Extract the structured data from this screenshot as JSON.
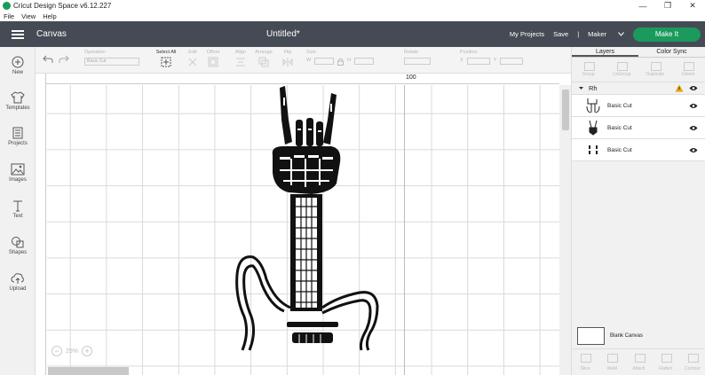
{
  "app": {
    "title": "Cricut Design Space  v6.12.227"
  },
  "menu": [
    "File",
    "View",
    "Help"
  ],
  "header": {
    "section": "Canvas",
    "doc_title": "Untitled*",
    "my_projects": "My Projects",
    "save": "Save",
    "separator": "|",
    "machine": "Maker",
    "make_it": "Make It"
  },
  "sidebar": [
    {
      "label": "New",
      "icon": "plus-circle-icon"
    },
    {
      "label": "Templates",
      "icon": "shirt-icon"
    },
    {
      "label": "Projects",
      "icon": "projects-icon"
    },
    {
      "label": "Images",
      "icon": "image-icon"
    },
    {
      "label": "Text",
      "icon": "text-icon"
    },
    {
      "label": "Shapes",
      "icon": "shapes-icon"
    },
    {
      "label": "Upload",
      "icon": "upload-icon"
    }
  ],
  "toolbar": {
    "operation_label": "Operation",
    "operation_value": "Basic Cut",
    "select_all": "Select All",
    "edit": "Edit",
    "offset": "Offset",
    "align": "Align",
    "arrange": "Arrange",
    "flip": "Flip",
    "size": "Size",
    "w": "W",
    "h": "H",
    "rotate": "Rotate",
    "position": "Position",
    "x": "X",
    "y": "Y"
  },
  "canvas": {
    "ruler_mark": "100",
    "zoom": "25%"
  },
  "panel": {
    "tabs": [
      "Layers",
      "Color Sync"
    ],
    "top_tools": [
      "Group",
      "UnGroup",
      "Duplicate",
      "Delete"
    ],
    "group_name": "Rh",
    "layers": [
      {
        "name": "Basic Cut"
      },
      {
        "name": "Basic Cut"
      },
      {
        "name": "Basic Cut"
      }
    ],
    "blank_canvas": "Blank Canvas",
    "bottom_tools": [
      "Slice",
      "Weld",
      "Attach",
      "Flatten",
      "Contour"
    ]
  },
  "colors": {
    "header": "#454b54",
    "accent": "#1a9a5c",
    "warning": "#e8a100"
  }
}
